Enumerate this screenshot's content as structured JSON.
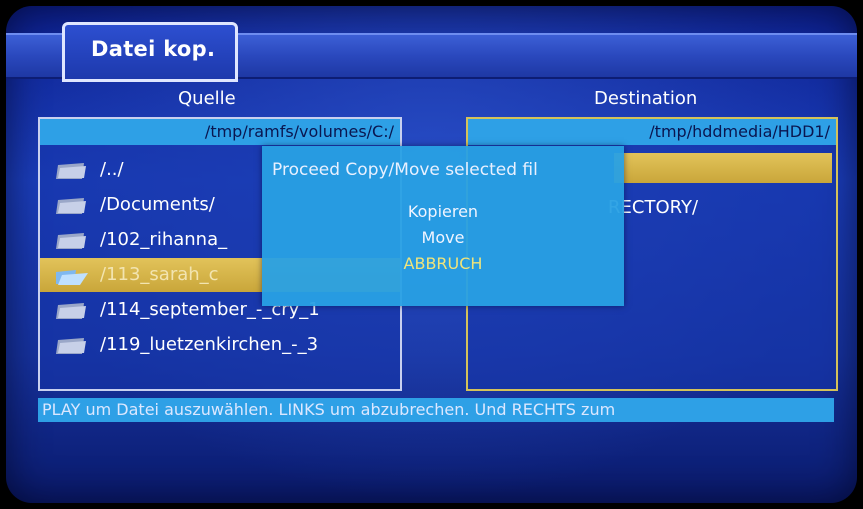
{
  "title": "Datei kop.",
  "source": {
    "header": "Quelle",
    "path": "/tmp/ramfs/volumes/C:/",
    "items": [
      {
        "name": "/../"
      },
      {
        "name": "/Documents/"
      },
      {
        "name": "/102_rihanna_"
      },
      {
        "name": "/113_sarah_c"
      },
      {
        "name": "/114_september_-_cry_1"
      },
      {
        "name": "/119_luetzenkirchen_-_3"
      }
    ],
    "selected_index": 3
  },
  "destination": {
    "header": "Destination",
    "path": "/tmp/hddmedia/HDD1/",
    "items": [
      {
        "name": "RECTORY/"
      }
    ]
  },
  "dialog": {
    "message": "Proceed Copy/Move selected fil",
    "options": [
      "Kopieren",
      "Move",
      "ABBRUCH"
    ],
    "active_option": 2
  },
  "status": "PLAY um Datei auszuwählen. LINKS um abzubrechen. Und RECHTS zum",
  "colors": {
    "background": "#1a3cb8",
    "selection": "#d6b64a",
    "info_bar": "#2ea0e6",
    "highlight_text": "#f0e47a"
  },
  "icons": {
    "folder": "folder-icon",
    "open_folder": "open-folder-icon"
  }
}
